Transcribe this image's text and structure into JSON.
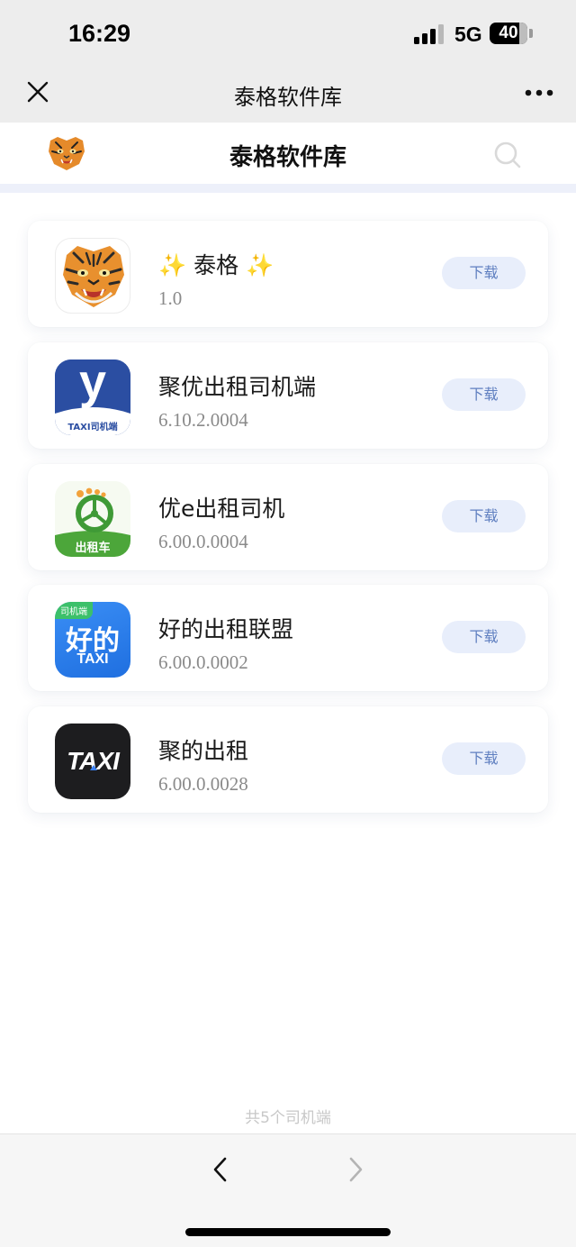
{
  "status_bar": {
    "time": "16:29",
    "network": "5G",
    "battery": "40"
  },
  "nav_bar": {
    "title": "泰格软件库",
    "close_icon": "close-icon",
    "more_icon": "more-icon"
  },
  "header": {
    "title": "泰格软件库",
    "logo": "tiger-logo-icon",
    "search_icon": "search-icon"
  },
  "apps": [
    {
      "name": "✨ 泰格 ✨",
      "version": "1.0",
      "button": "下载",
      "icon": "tiger-app-icon"
    },
    {
      "name": "聚优出租司机端",
      "version": "6.10.2.0004",
      "button": "下载",
      "icon": "juyou-taxi-app-icon",
      "icon_caption": "TAXI司机端",
      "icon_letter": "y"
    },
    {
      "name": "优e出租司机",
      "version": "6.00.0.0004",
      "button": "下载",
      "icon": "youe-taxi-app-icon",
      "icon_caption": "出租车"
    },
    {
      "name": "好的出租联盟",
      "version": "6.00.0.0002",
      "button": "下载",
      "icon": "haode-taxi-app-icon",
      "icon_badge": "司机端",
      "icon_title": "好的",
      "icon_sub": "TAXI"
    },
    {
      "name": "聚的出租",
      "version": "6.00.0.0028",
      "button": "下载",
      "icon": "jude-taxi-app-icon",
      "icon_title": "TAXI"
    }
  ],
  "footer": {
    "count_text": "共5个司机端"
  },
  "bottom_bar": {
    "back_icon": "chevron-left-icon",
    "forward_icon": "chevron-right-icon"
  },
  "colors": {
    "chrome_bg": "#ededed",
    "button_bg": "#e8eefb",
    "button_text": "#5f7fc0",
    "divider": "#edf0fa"
  }
}
